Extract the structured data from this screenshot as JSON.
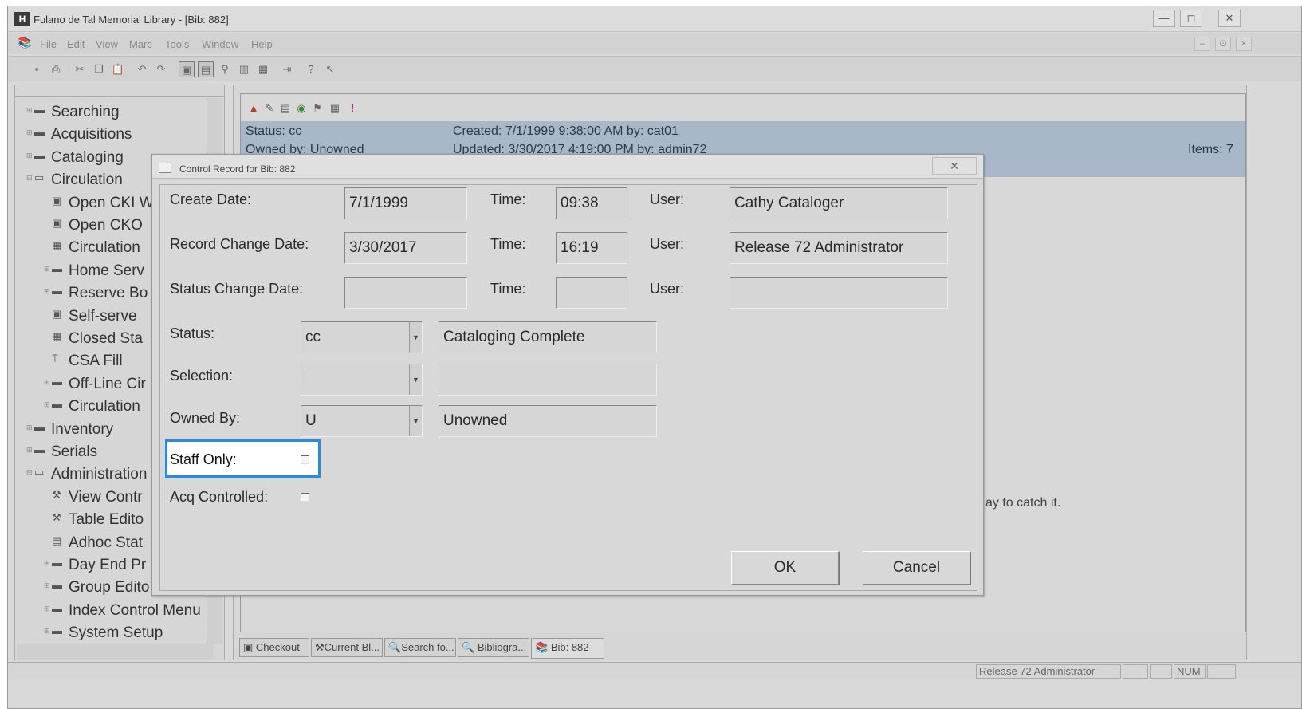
{
  "window": {
    "title": "Fulano de Tal Memorial Library - [Bib: 882]",
    "controls": [
      "—",
      "◻",
      "✕"
    ]
  },
  "menu": {
    "items": [
      "File",
      "Edit",
      "View",
      "Marc",
      "Tools",
      "Window",
      "Help"
    ],
    "mdi_controls": [
      "–",
      "ʘ",
      "×"
    ]
  },
  "toolbar": {
    "icons": [
      "save-icon",
      "print-icon",
      "cut-icon",
      "copy-icon",
      "paste-icon",
      "undo-icon",
      "redo-icon",
      "view-a-icon",
      "view-b-icon",
      "find-icon",
      "barcode-icon",
      "form-icon",
      "import-icon",
      "help-icon",
      "context-help-icon"
    ]
  },
  "nav_tree": {
    "items": [
      {
        "label": "Searching",
        "level": 0,
        "icon": "folder-icon"
      },
      {
        "label": "Acquisitions",
        "level": 0,
        "icon": "folder-icon"
      },
      {
        "label": "Cataloging",
        "level": 0,
        "icon": "folder-icon"
      },
      {
        "label": "Circulation",
        "level": 0,
        "icon": "folder-open-icon"
      },
      {
        "label": "Open CKI W",
        "level": 1,
        "icon": "window-icon"
      },
      {
        "label": "Open CKO",
        "level": 1,
        "icon": "window-icon"
      },
      {
        "label": "Circulation",
        "level": 1,
        "icon": "calendar-icon"
      },
      {
        "label": "Home Serv",
        "level": 1,
        "icon": "folder-icon"
      },
      {
        "label": "Reserve Bo",
        "level": 1,
        "icon": "folder-icon"
      },
      {
        "label": "Self-serve",
        "level": 1,
        "icon": "window-icon"
      },
      {
        "label": "Closed Sta",
        "level": 1,
        "icon": "grid-icon"
      },
      {
        "label": "CSA Fill",
        "level": 1,
        "icon": "fill-icon"
      },
      {
        "label": "Off-Line Cir",
        "level": 1,
        "icon": "folder-icon"
      },
      {
        "label": "Circulation",
        "level": 1,
        "icon": "folder-icon"
      },
      {
        "label": "Inventory",
        "level": 0,
        "icon": "folder-icon"
      },
      {
        "label": "Serials",
        "level": 0,
        "icon": "folder-icon"
      },
      {
        "label": "Administration",
        "level": 0,
        "icon": "folder-open-icon"
      },
      {
        "label": "View Contr",
        "level": 1,
        "icon": "tools-icon"
      },
      {
        "label": "Table Edito",
        "level": 1,
        "icon": "tools-icon"
      },
      {
        "label": "Adhoc Stat",
        "level": 1,
        "icon": "report-icon"
      },
      {
        "label": "Day End Pr",
        "level": 1,
        "icon": "folder-icon"
      },
      {
        "label": "Group Edito",
        "level": 1,
        "icon": "folder-icon"
      },
      {
        "label": "Index Control Menu",
        "level": 1,
        "icon": "folder-icon"
      },
      {
        "label": "System Setup",
        "level": 1,
        "icon": "folder-icon"
      }
    ]
  },
  "record_header": {
    "status": "Status: cc",
    "owned_by": "Owned by: Unowned",
    "created": "Created: 7/1/1999 9:38:00 AM by: cat01",
    "updated": "Updated: 3/30/2017 4:19:00 PM by: admin72",
    "items": "Items: 7",
    "note_fragment": "ay to catch it."
  },
  "dialog": {
    "title": "Control Record for Bib: 882",
    "close_glyph": "✕",
    "create_date_label": "Create Date:",
    "create_date": "7/1/1999",
    "create_time_label": "Time:",
    "create_time": "09:38",
    "create_user_label": "User:",
    "create_user": "Cathy Cataloger",
    "change_date_label": "Record Change Date:",
    "change_date": "3/30/2017",
    "change_time_label": "Time:",
    "change_time": "16:19",
    "change_user_label": "User:",
    "change_user": "Release 72 Administrator",
    "status_change_label": "Status Change Date:",
    "status_change_date": "",
    "status_change_time_label": "Time:",
    "status_change_time": "",
    "status_change_user_label": "User:",
    "status_change_user": "",
    "status_label": "Status:",
    "status_code": "cc",
    "status_desc": "Cataloging Complete",
    "selection_label": "Selection:",
    "selection_code": "",
    "selection_desc": "",
    "owned_by_label": "Owned By:",
    "owned_by_code": "U",
    "owned_by_desc": "Unowned",
    "staff_only_label": "Staff Only:",
    "staff_only_checked": false,
    "acq_controlled_label": "Acq Controlled:",
    "acq_controlled_checked": false,
    "ok_label": "OK",
    "cancel_label": "Cancel",
    "focus_color": "#1e8ee8"
  },
  "doc_tabs": [
    "Checkout",
    "Current Bl...",
    "Search fo...",
    "Bibliogra...",
    "Bib: 882"
  ],
  "statusbar": {
    "user": "Release 72 Administrator",
    "num": "NUM"
  }
}
